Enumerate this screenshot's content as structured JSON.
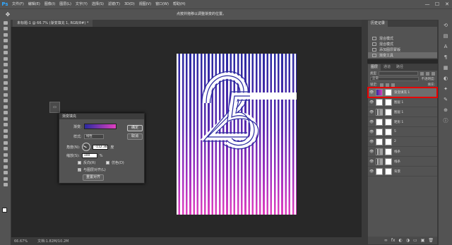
{
  "menubar": {
    "logo": "Ps",
    "items": [
      "文件(F)",
      "编辑(E)",
      "图像(I)",
      "图层(L)",
      "文字(Y)",
      "选择(S)",
      "滤镜(T)",
      "3D(D)",
      "视图(V)",
      "窗口(W)",
      "帮助(H)"
    ],
    "window_buttons": [
      "—",
      "☐",
      "✕"
    ]
  },
  "optionsbar": {
    "hint": "点按并拖移以调整渐变的位置。"
  },
  "document": {
    "tab_label": "未标题-1 @ 66.7% (渐变填充 1, RGB/8#) *"
  },
  "mini_panel_label": "▭",
  "statusbar": {
    "zoom": "66.67%",
    "doc_info": "文档:1.82M/10.2M"
  },
  "history_panel": {
    "tabs": [
      "历史记录"
    ],
    "rows": [
      "混合模式",
      "混合模式",
      "添加图层蒙版",
      "渐变工具"
    ],
    "selected_index": 3
  },
  "layers_panel": {
    "tabs": [
      "图层",
      "通道",
      "路径"
    ],
    "filter_label": "类型",
    "blend_mode": "正常",
    "opacity_label": "不透明度:",
    "lock_label": "锁定:",
    "fill_label": "填充:",
    "layers": [
      {
        "name": "渐变填充 1",
        "thumb": "grad",
        "selected": true
      },
      {
        "name": "图层 1",
        "thumb": "white",
        "selected": false
      },
      {
        "name": "图层 1",
        "thumb": "bars",
        "selected": false
      },
      {
        "name": "矩形 1",
        "thumb": "white",
        "selected": false
      },
      {
        "name": "5",
        "thumb": "white",
        "selected": false
      },
      {
        "name": "2",
        "thumb": "white",
        "selected": false
      },
      {
        "name": "线条",
        "thumb": "bars",
        "selected": false
      },
      {
        "name": "线条",
        "thumb": "bars",
        "selected": false
      },
      {
        "name": "背景",
        "thumb": "white",
        "selected": false
      }
    ],
    "footer_icons": [
      "∞",
      "fx",
      "◐",
      "◑",
      "▭",
      "▣",
      "🗑"
    ]
  },
  "gradient_dialog": {
    "title": "渐变填充",
    "gradient_label": "渐变:",
    "style_label": "样式:",
    "style_value": "线性",
    "angle_label": "角度(N):",
    "angle_value": "-112.38",
    "angle_unit": "度",
    "scale_label": "缩放(S):",
    "scale_value": "100",
    "scale_unit": "%",
    "reverse_label": "反向(R)",
    "dither_label": "仿色(D)",
    "align_label": "与图层对齐(L)",
    "reset_label": "重置对齐",
    "ok_label": "确定",
    "cancel_label": "取消"
  },
  "colors": {
    "gradient_start": "#2a2aa0",
    "gradient_end": "#e040c0",
    "selection_outline": "#e60000"
  }
}
